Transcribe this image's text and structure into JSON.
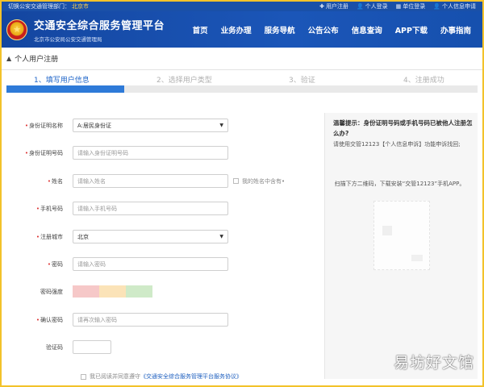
{
  "topbar": {
    "switch_text": "切换公安交通管理部门：",
    "city": "北京市",
    "links": [
      "用户注册",
      "个人登录",
      "单位登录",
      "个人信息申请"
    ]
  },
  "header": {
    "title": "交通安全综合服务管理平台",
    "subtitle": "北京市公安局公安交通管理局",
    "nav": [
      "首页",
      "业务办理",
      "服务导航",
      "公告公布",
      "信息查询",
      "APP下载",
      "办事指南"
    ]
  },
  "breadcrumb": {
    "label": "个人用户注册"
  },
  "steps": {
    "items": [
      "1、填写用户信息",
      "2、选择用户类型",
      "3、验证",
      "4、注册成功"
    ],
    "active": 0,
    "progress": 0.25
  },
  "form": {
    "id_type": {
      "label": "身份证明名称",
      "value": "A:居民身份证"
    },
    "id_number": {
      "label": "身份证明号码",
      "placeholder": "请输入身份证明号码"
    },
    "name": {
      "label": "姓名",
      "placeholder": "请输入姓名",
      "extra_check": "我的姓名中含有•"
    },
    "phone": {
      "label": "手机号码",
      "placeholder": "请输入手机号码"
    },
    "city": {
      "label": "注册城市",
      "value": "北京"
    },
    "password": {
      "label": "密码",
      "placeholder": "请输入密码"
    },
    "strength": {
      "label": "密码强度",
      "colors": [
        "#f6c8c8",
        "#fbe3b8",
        "#cfeac8"
      ]
    },
    "confirm": {
      "label": "确认密码",
      "placeholder": "请再次输入密码"
    },
    "captcha": {
      "label": "验证码"
    },
    "agree": {
      "prefix": "我已阅读并同意遵守",
      "link": "《交通安全综合服务管理平台服务协议》"
    }
  },
  "tips": {
    "title": "温馨提示：身份证明号码或手机号码已被他人注册怎么办?",
    "text": "请使用交管12123【个人信息申诉】功能申诉找回;",
    "scan": "扫描下方二维码，下载安装“交管12123”手机APP。"
  },
  "watermark": "易坊好文馆",
  "colors": {
    "brand": "#1a50a8",
    "accent": "#2e7ad8",
    "frame": "#f3c22a"
  }
}
